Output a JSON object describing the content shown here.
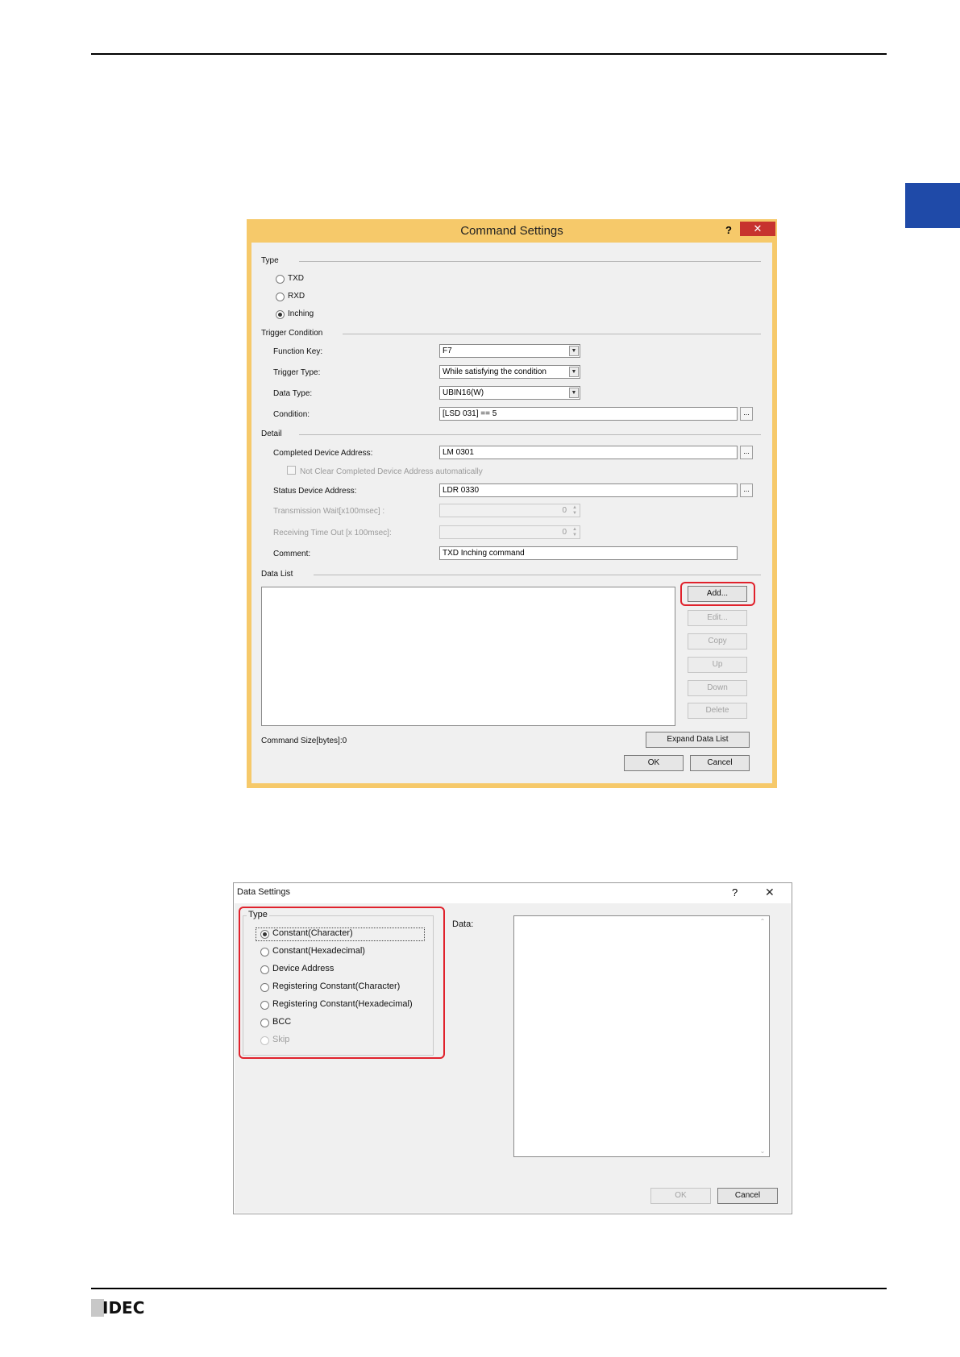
{
  "brand": "IDEC",
  "colors": {
    "tab_marker": "#1f4aa8",
    "highlight": "#e0222c",
    "dialog_frame": "#f6c96a"
  },
  "command_dialog": {
    "title": "Command Settings",
    "help": "?",
    "close": "✕",
    "type_section": "Type",
    "type_options": [
      "TXD",
      "RXD",
      "Inching"
    ],
    "selected_type": "Inching",
    "trigger_section": "Trigger Condition",
    "function_key_label": "Function Key:",
    "function_key_value": "F7",
    "trigger_type_label": "Trigger Type:",
    "trigger_type_value": "While satisfying the condition",
    "data_type_label": "Data Type:",
    "data_type_value": "UBIN16(W)",
    "condition_label": "Condition:",
    "condition_value": "[LSD 031] == 5",
    "detail_section": "Detail",
    "completed_addr_label": "Completed Device Address:",
    "completed_addr_value": "LM 0301",
    "not_clear_label": "Not Clear Completed Device Address automatically",
    "status_addr_label": "Status Device Address:",
    "status_addr_value": "LDR 0330",
    "tx_wait_label": "Transmission Wait[x100msec] :",
    "tx_wait_value": "0",
    "rx_timeout_label": "Receiving Time Out [x 100msec]:",
    "rx_timeout_value": "0",
    "comment_label": "Comment:",
    "comment_value": "TXD Inching command",
    "data_list_section": "Data List",
    "buttons": {
      "add": "Add...",
      "edit": "Edit...",
      "copy": "Copy",
      "up": "Up",
      "down": "Down",
      "delete": "Delete",
      "expand": "Expand Data List",
      "ok": "OK",
      "cancel": "Cancel"
    },
    "command_size": "Command Size[bytes]:0",
    "ellipsis": "..."
  },
  "data_dialog": {
    "title": "Data Settings",
    "help": "?",
    "close": "✕",
    "type_section": "Type",
    "type_options": [
      "Constant(Character)",
      "Constant(Hexadecimal)",
      "Device Address",
      "Registering Constant(Character)",
      "Registering Constant(Hexadecimal)",
      "BCC",
      "Skip"
    ],
    "selected_type": "Constant(Character)",
    "data_label": "Data:",
    "ok": "OK",
    "cancel": "Cancel"
  }
}
